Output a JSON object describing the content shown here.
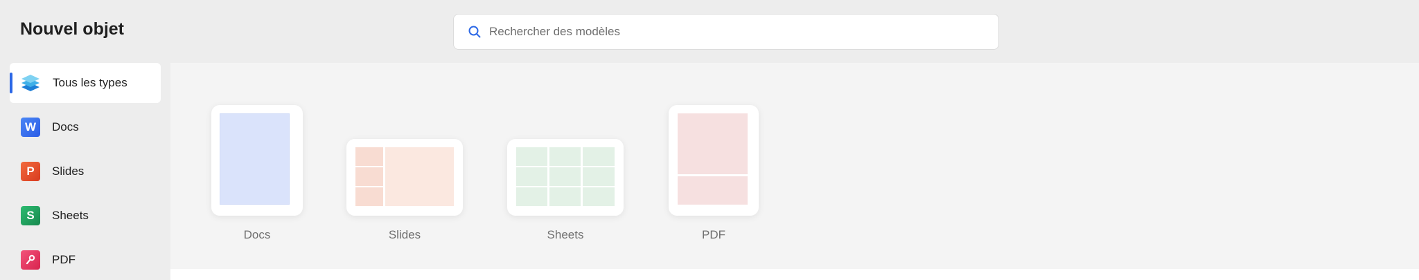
{
  "page_title": "Nouvel objet",
  "search": {
    "placeholder": "Rechercher des modèles"
  },
  "sidebar": {
    "items": [
      {
        "label": "Tous les types",
        "icon": "layers-icon",
        "active": true
      },
      {
        "label": "Docs",
        "icon": "docs-w-icon",
        "glyph": "W",
        "color": "#2b5ce6"
      },
      {
        "label": "Slides",
        "icon": "slides-p-icon",
        "glyph": "P",
        "color": "#e0482a"
      },
      {
        "label": "Sheets",
        "icon": "sheets-s-icon",
        "glyph": "S",
        "color": "#1e9d5c"
      },
      {
        "label": "PDF",
        "icon": "pdf-icon",
        "color": "#e6345a"
      }
    ]
  },
  "templates": [
    {
      "label": "Docs",
      "thumb_color": "#dae3fb"
    },
    {
      "label": "Slides",
      "thumb_color": "#fbe8e0"
    },
    {
      "label": "Sheets",
      "thumb_color": "#e3f1e6"
    },
    {
      "label": "PDF",
      "thumb_color": "#f6e0e0"
    }
  ]
}
